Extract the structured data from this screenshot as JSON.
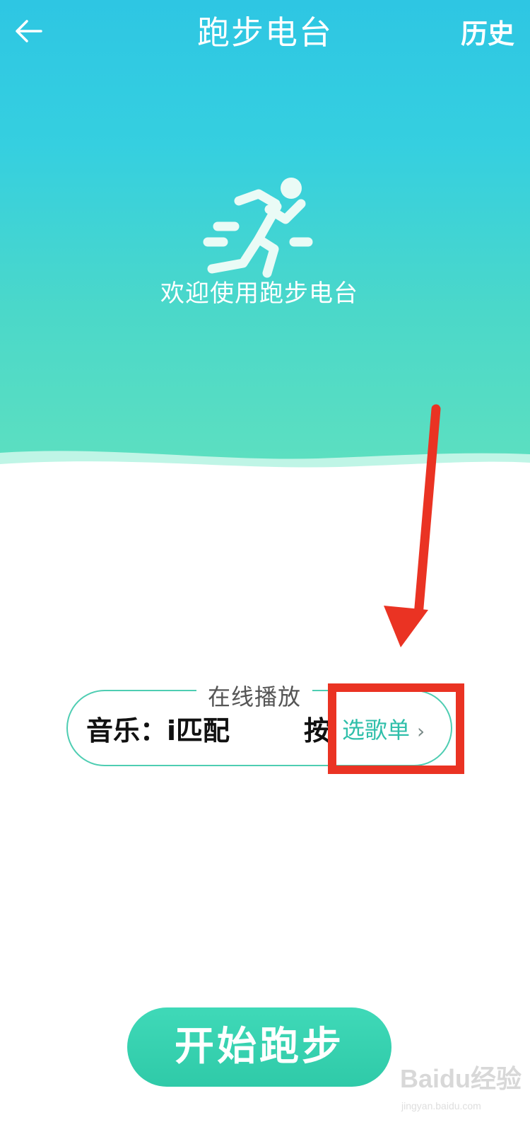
{
  "header": {
    "title": "跑步电台",
    "history_label": "历史"
  },
  "hero": {
    "welcome_text": "欢迎使用跑步电台"
  },
  "online_play": {
    "legend": "在线播放",
    "music_text": "音乐：i匹配",
    "press_text": "按",
    "select_playlist_label": "选歌单",
    "select_playlist_chevron": "›"
  },
  "actions": {
    "start_label": "开始跑步"
  },
  "watermark": {
    "brand": "Baidu经验",
    "sub": "jingyan.baidu.com"
  },
  "colors": {
    "accent": "#4ecdb2",
    "annotation": "#ea3323"
  },
  "icons": {
    "back": "back-arrow-icon",
    "runner": "runner-icon",
    "chevron": "chevron-right-icon"
  }
}
